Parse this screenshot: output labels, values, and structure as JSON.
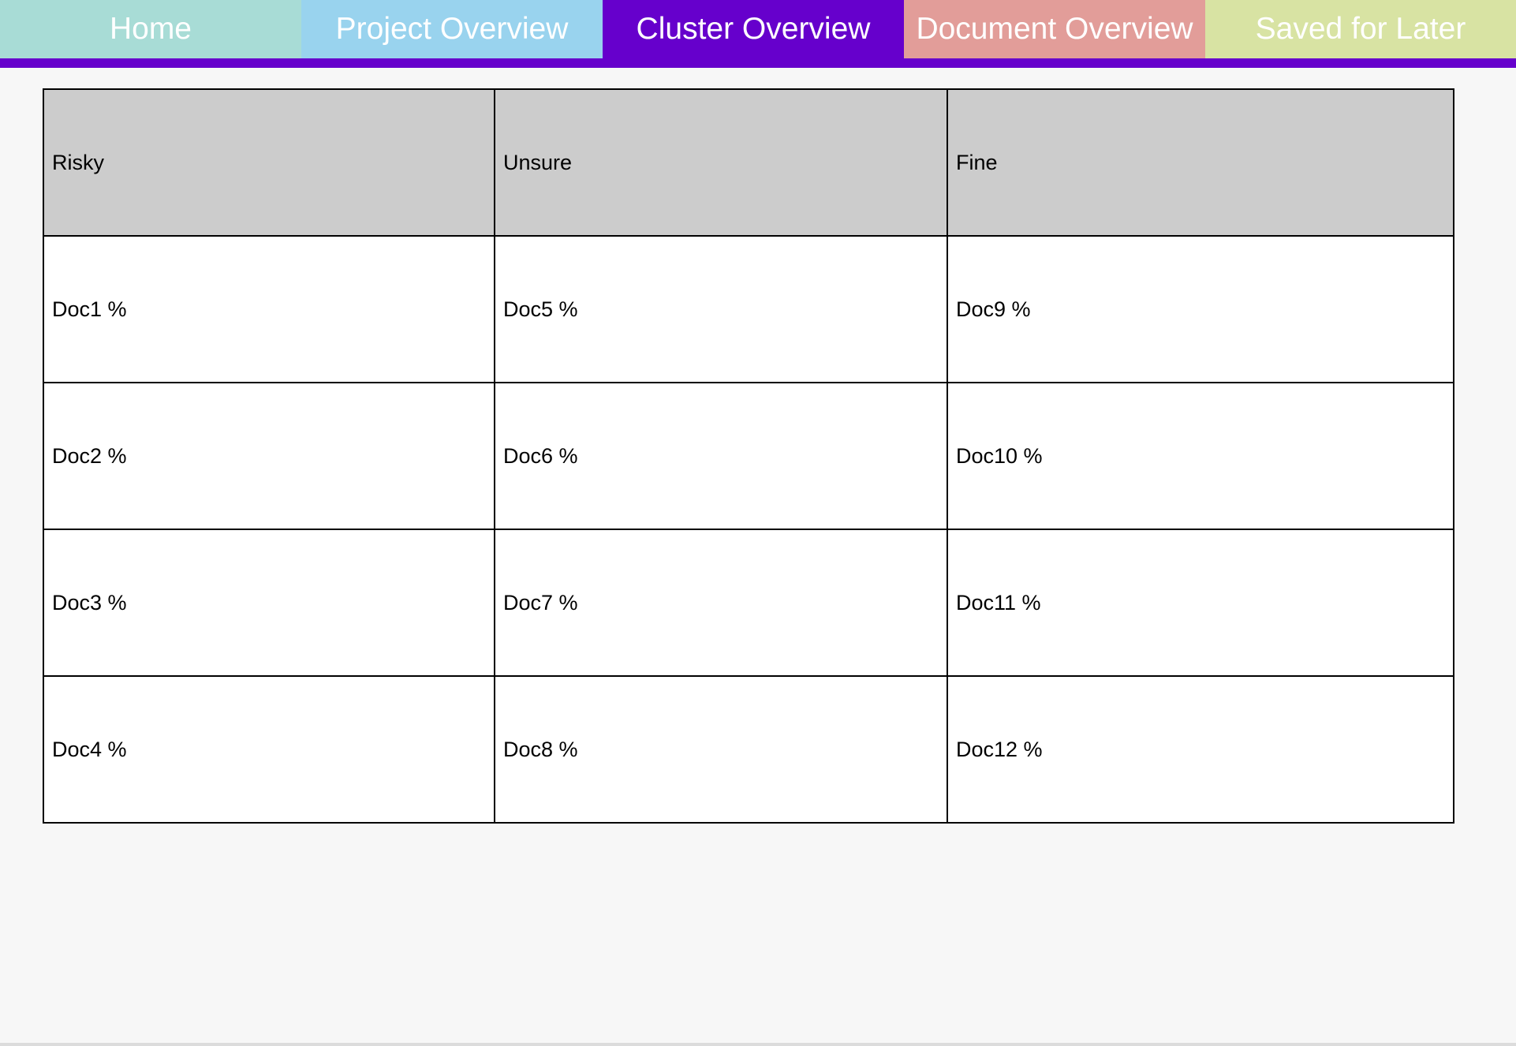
{
  "nav": {
    "tabs": [
      {
        "label": "Home",
        "color": "#a8dcd6",
        "active": false
      },
      {
        "label": "Project Overview",
        "color": "#99d3ee",
        "active": false
      },
      {
        "label": "Cluster Overview",
        "color": "#6600cc",
        "active": true
      },
      {
        "label": "Document Overview",
        "color": "#e29d99",
        "active": false
      },
      {
        "label": "Saved for Later",
        "color": "#d8e3a3",
        "active": false
      }
    ],
    "underline_color": "#6600cc"
  },
  "table": {
    "headers": [
      "Risky",
      "Unsure",
      "Fine"
    ],
    "rows": [
      [
        "Doc1 %",
        "Doc5 %",
        "Doc9 %"
      ],
      [
        "Doc2 %",
        "Doc6 %",
        "Doc10 %"
      ],
      [
        "Doc3 %",
        "Doc7 %",
        "Doc11 %"
      ],
      [
        "Doc4 %",
        "Doc8 %",
        "Doc12 %"
      ]
    ]
  }
}
